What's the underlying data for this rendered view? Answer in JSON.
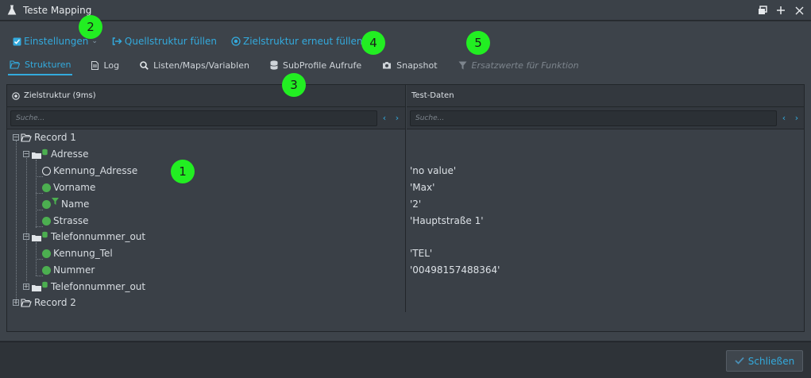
{
  "window": {
    "title": "Teste Mapping",
    "controls": [
      "restore",
      "maximize",
      "close"
    ]
  },
  "toolbar": {
    "settings_label": "Einstellungen",
    "fill_source_label": "Quellstruktur füllen",
    "refill_target_label": "Zielstruktur erneut füllen"
  },
  "tabs": [
    {
      "label": "Strukturen",
      "icon": "folder-open-icon",
      "active": true
    },
    {
      "label": "Log",
      "icon": "document-icon"
    },
    {
      "label": "Listen/Maps/Variablen",
      "icon": "search-icon"
    },
    {
      "label": "SubProfile Aufrufe",
      "icon": "database-icon"
    },
    {
      "label": "Snapshot",
      "icon": "camera-icon"
    },
    {
      "label": "Ersatzwerte für Funktion",
      "icon": "filter-icon",
      "disabled": true
    }
  ],
  "panel": {
    "left_header": "Zielstruktur (9ms)",
    "right_header": "Test-Daten",
    "left_search_placeholder": "Suche...",
    "right_search_placeholder": "Suche..."
  },
  "tree": [
    {
      "label": "Record 1",
      "type": "folder-open",
      "expanded": true
    },
    {
      "label": "Adresse",
      "type": "db-folder",
      "expanded": true
    },
    {
      "label": "Kennung_Adresse",
      "type": "empty-dot",
      "value": "'no value'"
    },
    {
      "label": "Vorname",
      "type": "dot",
      "value": "'Max'"
    },
    {
      "label": "Name",
      "type": "dot-filter",
      "value": "'2'"
    },
    {
      "label": "Strasse",
      "type": "dot",
      "value": "'Hauptstraße 1'"
    },
    {
      "label": "Telefonnummer_out",
      "type": "db-folder",
      "expanded": true
    },
    {
      "label": "Kennung_Tel",
      "type": "dot",
      "value": "'TEL'"
    },
    {
      "label": "Nummer",
      "type": "dot",
      "value": "'00498157488364'"
    },
    {
      "label": "Telefonnummer_out",
      "type": "db-folder",
      "expanded": false
    },
    {
      "label": "Record 2",
      "type": "folder-open",
      "expanded": false
    }
  ],
  "footer": {
    "close_label": "Schließen"
  },
  "annotations": [
    "1",
    "2",
    "3",
    "4",
    "5"
  ],
  "colors": {
    "accent": "#33aadd",
    "status_green": "#4caf50",
    "annotation_green": "#22ee22"
  }
}
